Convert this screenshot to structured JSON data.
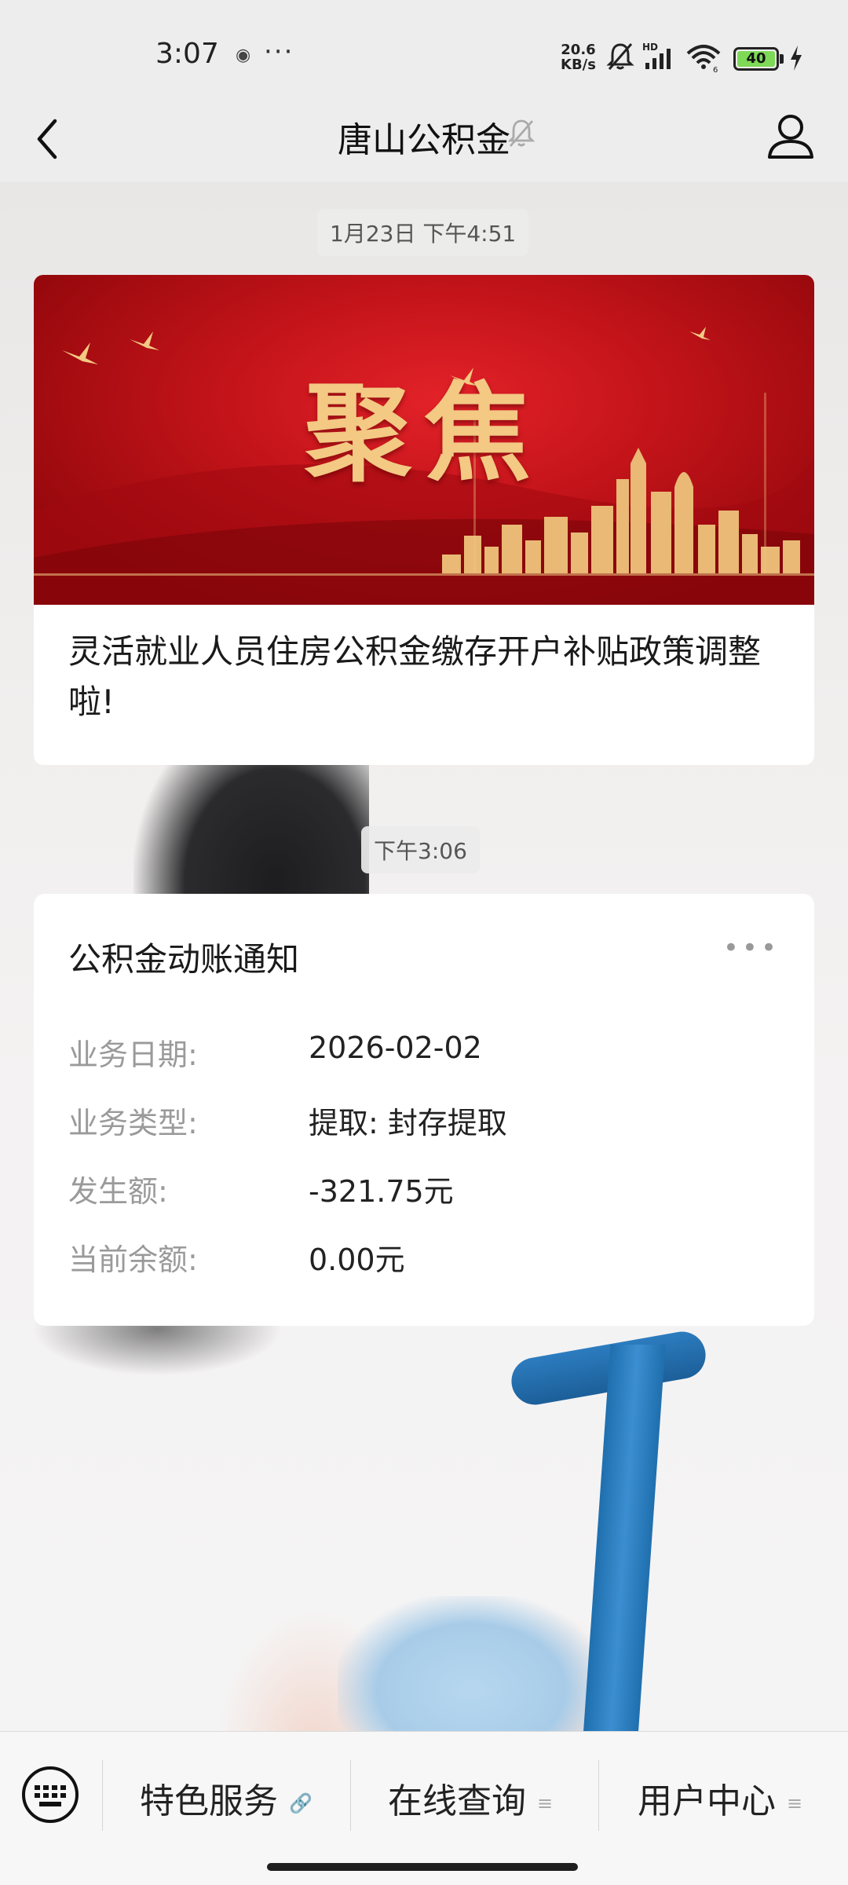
{
  "status_bar": {
    "time": "3:07",
    "more": "···",
    "net_speed_value": "20.6",
    "net_speed_unit": "KB/s",
    "battery_level": "40",
    "icons": [
      "mute-icon",
      "signal-icon",
      "wifi-icon",
      "battery-icon",
      "charging-icon"
    ]
  },
  "nav": {
    "title": "唐山公积金",
    "icons": [
      "back-icon",
      "mute-bell-icon",
      "user-profile-icon"
    ]
  },
  "messages": [
    {
      "time": "1月23日 下午4:51",
      "type": "article",
      "banner_text": "聚焦",
      "title": "灵活就业人员住房公积金缴存开户补贴政策调整啦!"
    },
    {
      "time": "下午3:06",
      "type": "notice",
      "title": "公积金动账通知",
      "rows": [
        {
          "label": "业务日期:",
          "value": "2026-02-02"
        },
        {
          "label": "业务类型:",
          "value": "提取: 封存提取"
        },
        {
          "label": "发生额:",
          "value": "-321.75元"
        },
        {
          "label": "当前余额:",
          "value": "0.00元"
        }
      ]
    }
  ],
  "bottom_menu": {
    "items": [
      {
        "label": "特色服务",
        "icon": "link-icon"
      },
      {
        "label": "在线查询",
        "icon": "menu-lines-icon"
      },
      {
        "label": "用户中心",
        "icon": "menu-lines-icon"
      }
    ],
    "keyboard_icon": "keyboard-icon"
  },
  "colors": {
    "banner_red": "#c4141a",
    "banner_gold": "#f3c983",
    "battery_green": "#7ed957"
  }
}
